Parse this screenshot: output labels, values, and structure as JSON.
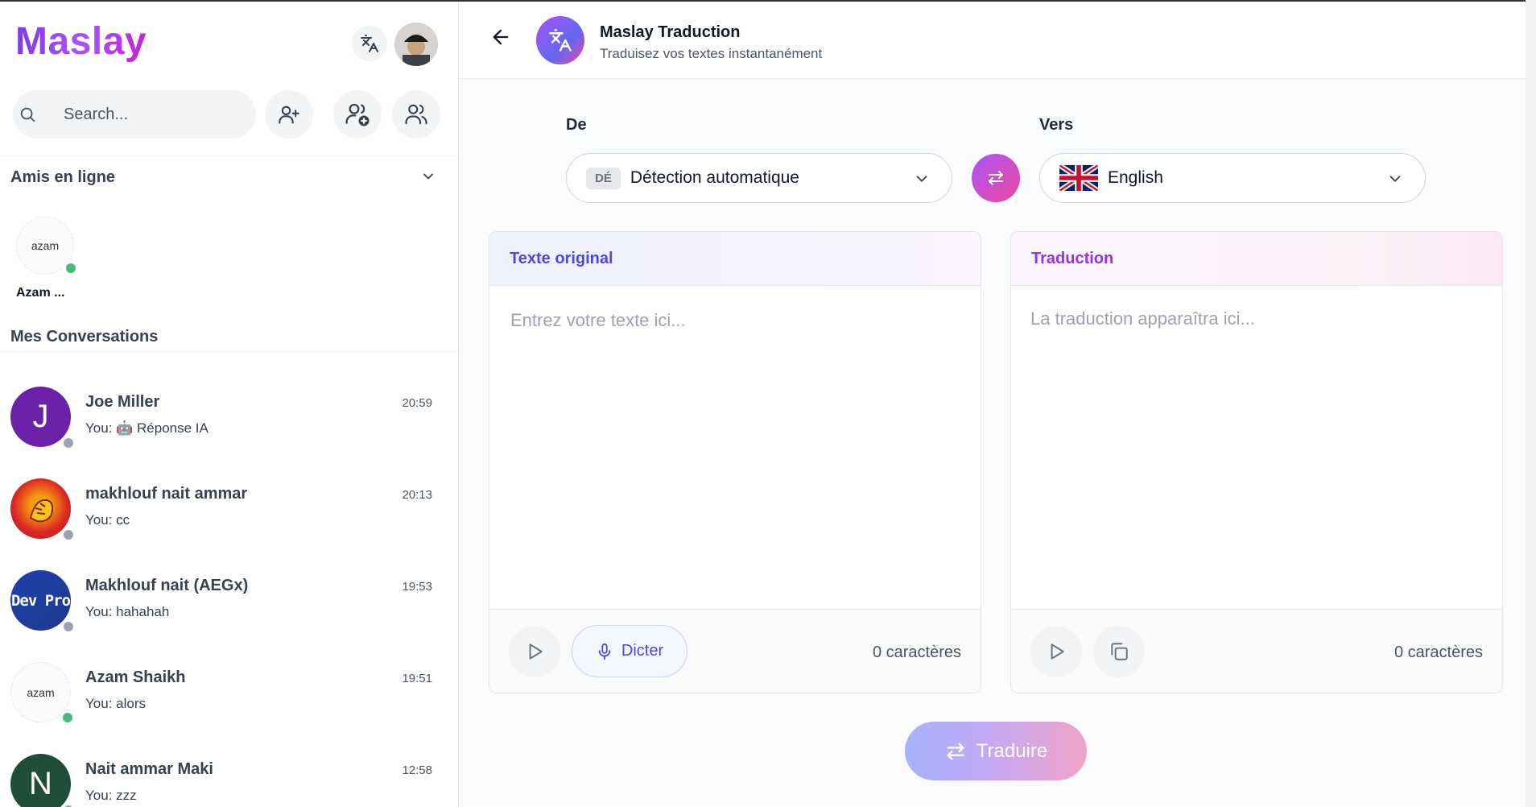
{
  "sidebar": {
    "logo": "Maslay",
    "search": {
      "placeholder": "Search..."
    },
    "online_section": {
      "title": "Amis en ligne"
    },
    "online_friends": [
      {
        "name": "Azam ...",
        "avatar_text": "azam",
        "status": "online"
      }
    ],
    "conversations_title": "Mes Conversations",
    "conversations": [
      {
        "name": "Joe Miller",
        "time": "20:59",
        "preview": "You: 🤖 Réponse IA",
        "avatar_letter": "J",
        "avatar_color": "#6b21a8",
        "status": "offline"
      },
      {
        "name": "makhlouf nait ammar",
        "time": "20:13",
        "preview": "You: cc",
        "avatar_letter": "",
        "avatar_color": "#c2410c",
        "status": "offline"
      },
      {
        "name": "Makhlouf nait (AEGx)",
        "time": "19:53",
        "preview": "You: hahahah",
        "avatar_letter": "Dev Pro",
        "avatar_color": "#1e3a8a",
        "status": "offline"
      },
      {
        "name": "Azam Shaikh",
        "time": "19:51",
        "preview": "You: alors",
        "avatar_letter": "azam",
        "avatar_color": "#fafafa",
        "status": "online"
      },
      {
        "name": "Nait ammar Maki",
        "time": "12:58",
        "preview": "You: zzz",
        "avatar_letter": "N",
        "avatar_color": "#1f4d3a",
        "status": "offline"
      }
    ]
  },
  "header": {
    "title": "Maslay Traduction",
    "subtitle": "Traduisez vos textes instantanément"
  },
  "languages": {
    "from_label": "De",
    "to_label": "Vers",
    "from_badge": "DÉ",
    "from_value": "Détection automatique",
    "to_value": "English"
  },
  "panels": {
    "original": {
      "title": "Texte original",
      "placeholder": "Entrez votre texte ici...",
      "dictate_label": "Dicter",
      "count": "0 caractères"
    },
    "translation": {
      "title": "Traduction",
      "placeholder": "La traduction apparaîtra ici...",
      "count": "0 caractères"
    }
  },
  "translate_button": "Traduire",
  "colors": {
    "accent": "#7c3aed",
    "online": "#22c55e",
    "offline": "#9ca3af",
    "brand_pink": "#ec4899"
  }
}
